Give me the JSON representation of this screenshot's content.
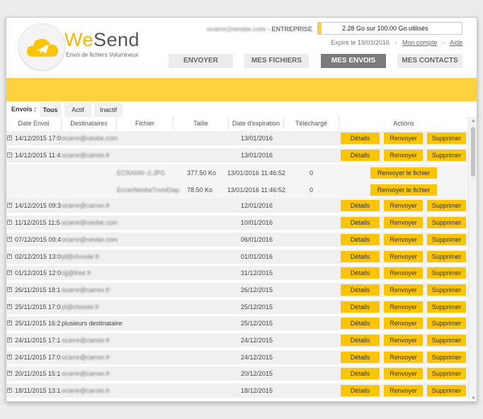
{
  "brand": {
    "name_we": "We",
    "name_send": "Send",
    "tagline": "Envoi de fichiers Volumineux"
  },
  "account": {
    "email": "ocarre@neobe.com",
    "separator": " - ",
    "plan": "ENTREPRISE",
    "quota_text": "2.28 Go sur 100.00 Go utilisés",
    "quota_fraction": 0.0228,
    "expiry": "Expire le 19/03/2016",
    "link_sep": "-",
    "my_account": "Mon compte",
    "help": "Aide"
  },
  "nav": {
    "send": "ENVOYER",
    "files": "MES FICHIERS",
    "sends": "MES ENVOIS",
    "contacts": "MES CONTACTS"
  },
  "filters": {
    "label": "Envois :",
    "all": "Tous",
    "active": "Actif",
    "inactive": "Inactif"
  },
  "columns": {
    "date_envoi": "Date Envoi",
    "destinataires": "Destinataires",
    "fichier": "Fichier",
    "taille": "Taille",
    "expiration": "Date d'expiration",
    "telecharge": "Téléchargé",
    "actions": "Actions"
  },
  "buttons": {
    "details": "Détails",
    "resend": "Renvoyer",
    "delete": "Supprimer",
    "resend_file": "Renvoyer le fichier"
  },
  "rows": [
    {
      "expander": "+",
      "date": "14/12/2015 17:0",
      "dest": "ocarre@neobe.com",
      "exp": "13/01/2016"
    },
    {
      "expander": "−",
      "date": "14/12/2015 11:4",
      "dest": "ocarre@carreo.fr",
      "exp": "13/01/2016"
    },
    {
      "expander": "+",
      "date": "14/12/2015 09:3",
      "dest": "ocarre@carreo.fr",
      "exp": "12/01/2016"
    },
    {
      "expander": "+",
      "date": "11/12/2015 11:5",
      "dest": "ocarre@neobe.com",
      "exp": "10/01/2016"
    },
    {
      "expander": "+",
      "date": "07/12/2015 09:4",
      "dest": "ocarre@neobe.com",
      "exp": "06/01/2016"
    },
    {
      "expander": "+",
      "date": "02/12/2015 13:0",
      "dest": "jd@chmole.fr",
      "exp": "01/01/2016"
    },
    {
      "expander": "+",
      "date": "01/12/2015 12:0",
      "dest": "ojj@free.fr",
      "exp": "31/12/2015"
    },
    {
      "expander": "+",
      "date": "26/11/2015 18:1",
      "dest": "ocarre@carreo.fr",
      "exp": "26/12/2015"
    },
    {
      "expander": "+",
      "date": "25/11/2015 17:0",
      "dest": "jd@chmole.fr",
      "exp": "25/12/2015"
    },
    {
      "expander": "+",
      "date": "25/11/2015 16:2",
      "dest": "plusieurs destinataires",
      "exp": "25/12/2015"
    },
    {
      "expander": "+",
      "date": "24/11/2015 17:1",
      "dest": "ocarre@carreo.fr",
      "exp": "24/12/2015"
    },
    {
      "expander": "+",
      "date": "24/11/2015 17:0",
      "dest": "ocarre@carreo.fr",
      "exp": "24/12/2015"
    },
    {
      "expander": "+",
      "date": "20/11/2015 15:1",
      "dest": "ocarre@carreo.fr",
      "exp": "20/12/2015"
    },
    {
      "expander": "+",
      "date": "18/11/2015 13:1",
      "dest": "ocarre@carreo.fr",
      "exp": "18/12/2015"
    }
  ],
  "subfiles": [
    {
      "file": "ECRANN~2.JPG",
      "size": "377.50 Ko",
      "exp": "13/01/2016 11:46:52",
      "downloads": "0"
    },
    {
      "file": "EcranNeobeTroisEtap",
      "size": "78.50 Ko",
      "exp": "13/01/2016 11:46:52",
      "downloads": "0"
    }
  ],
  "colors": {
    "accent": "#fed23e",
    "button": "#fcc500",
    "nav_active": "#7b7b7b"
  }
}
